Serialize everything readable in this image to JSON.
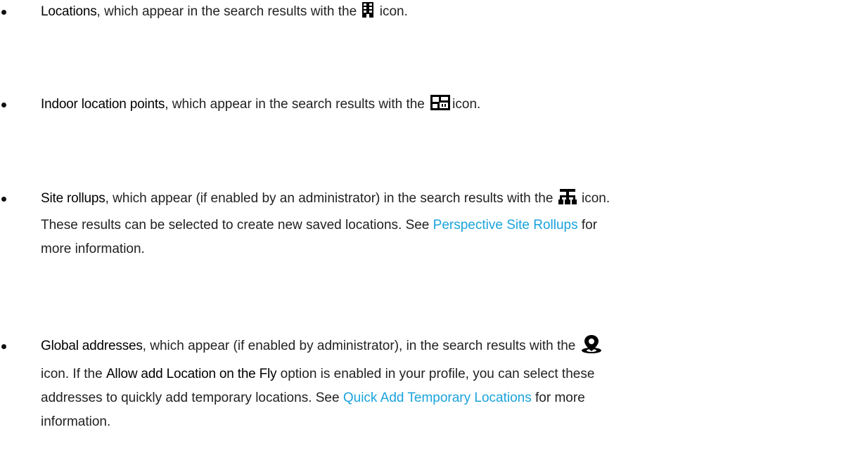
{
  "items": [
    {
      "term": "Locations",
      "pre_icon": ", which appear in the search results with the",
      "icon": "building-icon",
      "post_icon": " icon."
    },
    {
      "term": "Indoor location points",
      "pre_icon": ", which appear in the search results with the",
      "icon": "floor-plan-icon",
      "post_icon": "icon."
    },
    {
      "term": "Site rollups",
      "pre_icon": ", which appear (if enabled by an administrator) in the search results with the",
      "icon": "hierarchy-icon",
      "post_icon": " icon.",
      "line2": "These results can be selected to create new saved locations. See ",
      "link": "Perspective Site Rollups",
      "after_link": " for",
      "line3": "more information."
    },
    {
      "term": "Global addresses",
      "pre_icon": ", which appear (if enabled by administrator), in the search results with the",
      "icon": "map-pin-icon",
      "line2_a": "icon. If the ",
      "option": "Allow add Location on the Fly",
      "line2_b": " option is enabled in your profile, you can select these",
      "line3": "addresses to quickly add temporary locations. See ",
      "link": "Quick Add Temporary Locations",
      "after_link": " for more",
      "line4": "information."
    }
  ],
  "colors": {
    "text": "#222222",
    "term": "#000000",
    "link": "#1aa3dc"
  }
}
